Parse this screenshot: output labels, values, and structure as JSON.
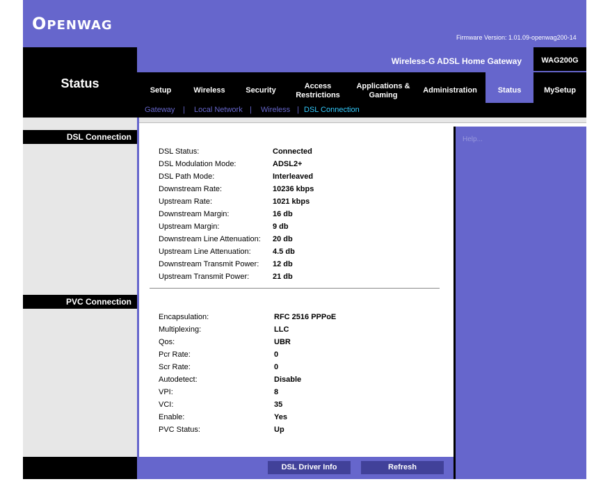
{
  "header": {
    "logo": "OpenWAG",
    "firmware": "Firmware Version: 1.01.09-openwag200-14",
    "product_name": "Wireless-G ADSL Home Gateway",
    "model": "WAG200G",
    "page_title": "Status"
  },
  "nav": {
    "tabs": [
      {
        "label": "Setup"
      },
      {
        "label": "Wireless"
      },
      {
        "label": "Security"
      },
      {
        "label": "Access Restrictions"
      },
      {
        "label": "Applications & Gaming"
      },
      {
        "label": "Administration"
      },
      {
        "label": "Status"
      },
      {
        "label": "MySetup"
      }
    ],
    "active_tab": "Status",
    "subtabs": [
      {
        "label": "Gateway"
      },
      {
        "label": "Local Network"
      },
      {
        "label": "Wireless"
      },
      {
        "label": "DSL Connection"
      }
    ],
    "active_subtab": "DSL Connection"
  },
  "sections": {
    "dsl_title": "DSL Connection",
    "pvc_title": "PVC Connection"
  },
  "help": "Help...",
  "dsl": [
    {
      "label": "DSL Status:",
      "value": "Connected"
    },
    {
      "label": "DSL Modulation Mode:",
      "value": "ADSL2+"
    },
    {
      "label": "DSL Path Mode:",
      "value": "Interleaved"
    },
    {
      "label": "Downstream Rate:",
      "value": "10236 kbps"
    },
    {
      "label": "Upstream Rate:",
      "value": "1021 kbps"
    },
    {
      "label": "Downstream Margin:",
      "value": "16 db"
    },
    {
      "label": "Upstream Margin:",
      "value": "9 db"
    },
    {
      "label": "Downstream Line Attenuation:",
      "value": "20 db"
    },
    {
      "label": "Upstream Line Attenuation:",
      "value": "4.5 db"
    },
    {
      "label": "Downstream Transmit Power:",
      "value": "12 db"
    },
    {
      "label": "Upstream Transmit Power:",
      "value": "21 db"
    }
  ],
  "pvc": [
    {
      "label": "Encapsulation:",
      "value": "RFC 2516 PPPoE"
    },
    {
      "label": "Multiplexing:",
      "value": "LLC"
    },
    {
      "label": "Qos:",
      "value": "UBR"
    },
    {
      "label": "Pcr Rate:",
      "value": "0"
    },
    {
      "label": "Scr Rate:",
      "value": "0"
    },
    {
      "label": "Autodetect:",
      "value": "Disable"
    },
    {
      "label": "VPI:",
      "value": "8"
    },
    {
      "label": "VCI:",
      "value": "35"
    },
    {
      "label": "Enable:",
      "value": "Yes"
    },
    {
      "label": "PVC Status:",
      "value": "Up"
    }
  ],
  "buttons": {
    "driver_info": "DSL Driver Info",
    "refresh": "Refresh"
  },
  "colors": {
    "brand_purple": "#6666cc",
    "active_subtab": "#33ccff",
    "button_bg": "#414199"
  }
}
